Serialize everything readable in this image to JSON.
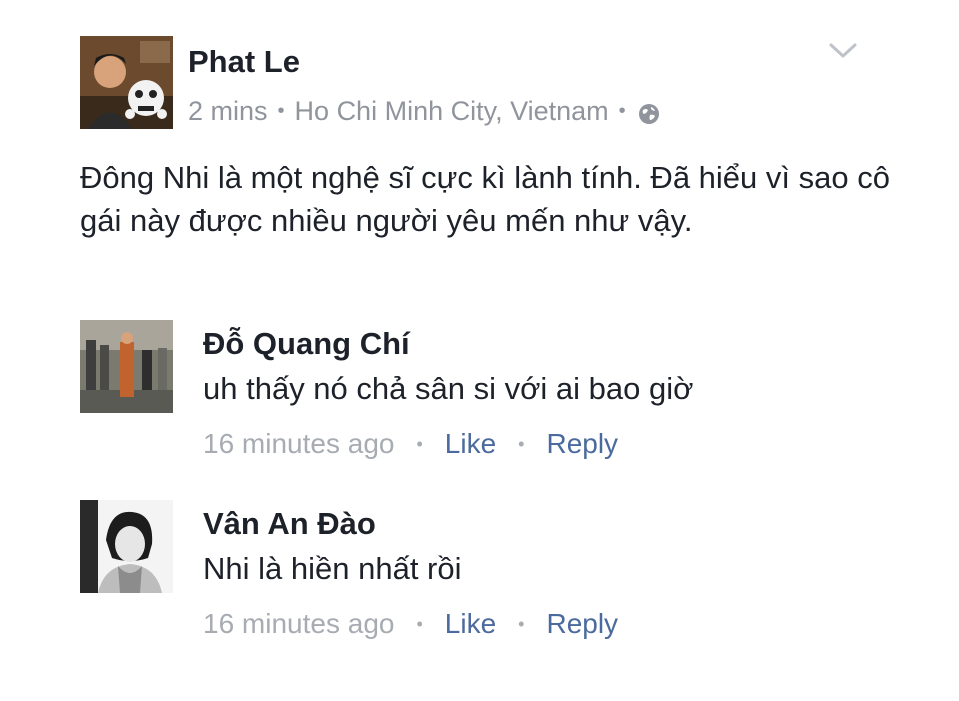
{
  "post": {
    "author": "Phat Le",
    "time": "2 mins",
    "location": "Ho Chi Minh City, Vietnam",
    "separator": "•",
    "privacy_icon": "globe-icon",
    "menu_icon": "chevron-down-icon",
    "text": "Đông Nhi là một nghệ sĩ cực kì lành tính. Đã hiểu vì sao cô gái này được nhiều người yêu mến như vậy."
  },
  "comments": [
    {
      "author": "Đỗ Quang Chí",
      "text": "uh thấy nó chả sân si với ai bao giờ",
      "time": "16 minutes ago",
      "like_label": "Like",
      "reply_label": "Reply",
      "separator": "•"
    },
    {
      "author": "Vân An Đào",
      "text": "Nhi là hiền nhất rồi",
      "time": "16 minutes ago",
      "like_label": "Like",
      "reply_label": "Reply",
      "separator": "•"
    }
  ],
  "colors": {
    "text": "#1d2129",
    "meta": "#90949c",
    "link": "#4b6a9d",
    "background": "#ffffff"
  }
}
